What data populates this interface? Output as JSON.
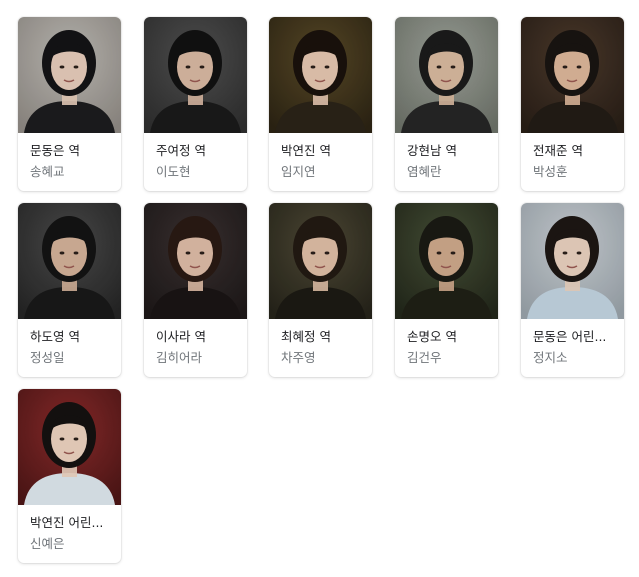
{
  "cast": [
    {
      "role": "문동은 역",
      "actor": "송혜교",
      "bg": "#bdbab5",
      "bg2": "#8f8a84",
      "hair": "#141416",
      "skin": "#e7cdbb",
      "clothes": "#1c1c1e"
    },
    {
      "role": "주여정 역",
      "actor": "이도현",
      "bg": "#505050",
      "bg2": "#2e2e2e",
      "hair": "#121212",
      "skin": "#d9b9a3",
      "clothes": "#1a1a1a"
    },
    {
      "role": "박연진 역",
      "actor": "임지연",
      "bg": "#5a4a26",
      "bg2": "#2c2414",
      "hair": "#1a120c",
      "skin": "#e6c7b1",
      "clothes": "#2b2418"
    },
    {
      "role": "강현남 역",
      "actor": "염혜란",
      "bg": "#9ea39a",
      "bg2": "#6c7168",
      "hair": "#1b1b1b",
      "skin": "#d9baa0",
      "clothes": "#262626"
    },
    {
      "role": "전재준 역",
      "actor": "박성훈",
      "bg": "#4d3a2c",
      "bg2": "#281e16",
      "hair": "#191512",
      "skin": "#ddb79b",
      "clothes": "#231c16"
    },
    {
      "role": "하도영 역",
      "actor": "정성일",
      "bg": "#4b4b4b",
      "bg2": "#252525",
      "hair": "#141414",
      "skin": "#d4b29a",
      "clothes": "#191919"
    },
    {
      "role": "이사라 역",
      "actor": "김히어라",
      "bg": "#3b3232",
      "bg2": "#1d1818",
      "hair": "#2a1a14",
      "skin": "#dfbda7",
      "clothes": "#1a1515"
    },
    {
      "role": "최혜정 역",
      "actor": "차주영",
      "bg": "#4f4a36",
      "bg2": "#26241a",
      "hair": "#231a13",
      "skin": "#e0bfa6",
      "clothes": "#1c1a14"
    },
    {
      "role": "손명오 역",
      "actor": "김건우",
      "bg": "#475037",
      "bg2": "#22271a",
      "hair": "#1a1a14",
      "skin": "#cfa98c",
      "clothes": "#1f2016"
    },
    {
      "role": "문동은 어린...",
      "actor": "정지소",
      "bg": "#c9cfd4",
      "bg2": "#9aa3aa",
      "hair": "#1d1714",
      "skin": "#ead2c0",
      "clothes": "#c3d5e2"
    },
    {
      "role": "박연진 어린...",
      "actor": "신예은",
      "bg": "#8b2a2a",
      "bg2": "#4d1616",
      "hair": "#151110",
      "skin": "#edd3c0",
      "clothes": "#dfe8ef"
    }
  ]
}
